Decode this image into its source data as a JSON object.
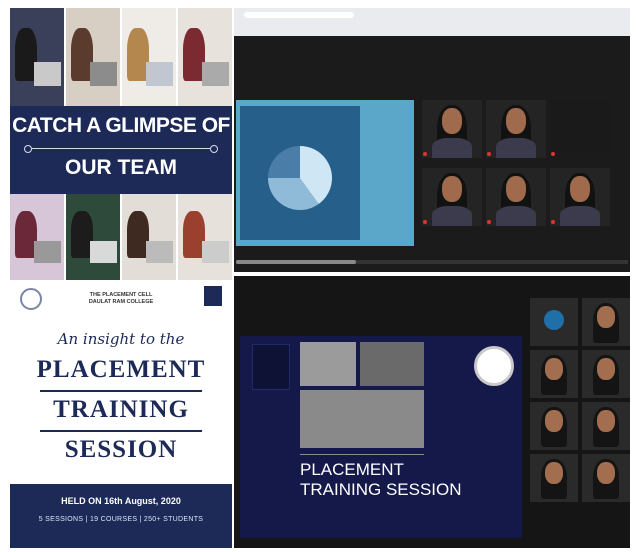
{
  "poster": {
    "headline_line1": "CATCH A GLIMPSE OF",
    "headline_line2": "OUR TEAM",
    "college_line1": "THE PLACEMENT CELL",
    "college_line2": "DAULAT RAM COLLEGE",
    "insight": "An insight to the",
    "word1": "PLACEMENT",
    "word2": "TRAINING",
    "word3": "SESSION",
    "held": "HELD ON 16th August, 2020",
    "stats": "5 SESSIONS | 19 COURSES | 250+ STUDENTS",
    "accent_color": "#1d2a58"
  },
  "screen_bottom": {
    "slide_title_line1": "PLACEMENT",
    "slide_title_line2": "TRAINING SESSION"
  }
}
